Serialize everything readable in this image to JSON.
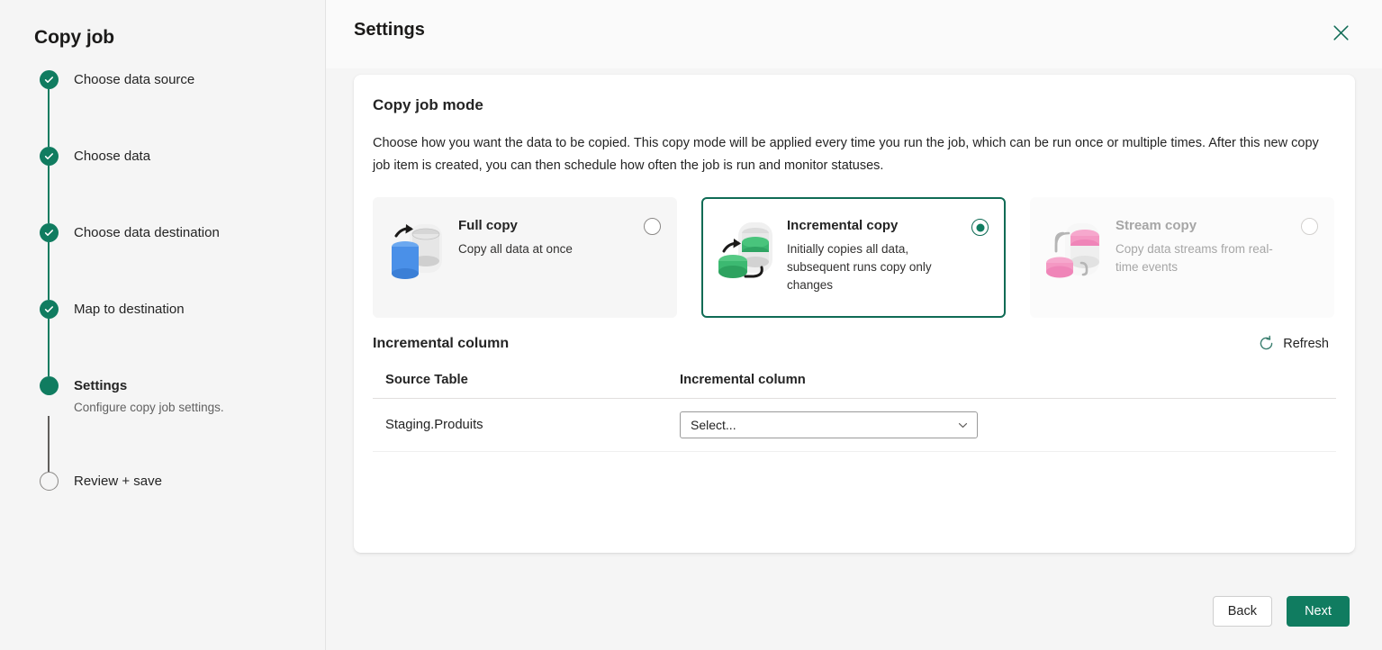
{
  "sidebar": {
    "title": "Copy job",
    "steps": [
      {
        "label": "Choose data source",
        "state": "done",
        "sub": ""
      },
      {
        "label": "Choose data",
        "state": "done",
        "sub": ""
      },
      {
        "label": "Choose data destination",
        "state": "done",
        "sub": ""
      },
      {
        "label": "Map to destination",
        "state": "done",
        "sub": ""
      },
      {
        "label": "Settings",
        "state": "current",
        "sub": "Configure copy job settings."
      },
      {
        "label": "Review + save",
        "state": "todo",
        "sub": ""
      }
    ]
  },
  "header": {
    "title": "Settings",
    "close_icon": "close-icon"
  },
  "panel": {
    "title": "Copy job mode",
    "description": "Choose how you want the data to be copied. This copy mode will be applied every time you run the job, which can be run once or multiple times. After this new copy job item is created, you can then schedule how often the job is run and monitor statuses.",
    "modes": [
      {
        "name": "Full copy",
        "sub": "Copy all data at once",
        "selected": false,
        "disabled": false,
        "icon": "database-full-copy-icon"
      },
      {
        "name": "Incremental copy",
        "sub": "Initially copies all data, subsequent runs copy only changes",
        "selected": true,
        "disabled": false,
        "icon": "database-incremental-copy-icon"
      },
      {
        "name": "Stream copy",
        "sub": "Copy data streams from real-time events",
        "selected": false,
        "disabled": true,
        "icon": "database-stream-copy-icon"
      }
    ]
  },
  "incremental": {
    "section_title": "Incremental column",
    "refresh_label": "Refresh",
    "refresh_icon": "refresh-icon",
    "columns": [
      "Source Table",
      "Incremental column"
    ],
    "rows": [
      {
        "source_table": "Staging.Produits",
        "incremental_column": "Select..."
      }
    ]
  },
  "footer": {
    "back_label": "Back",
    "next_label": "Next"
  },
  "colors": {
    "accent_green": "#107c60",
    "selected_border": "#0f6b55",
    "page_bg": "#f5f5f5",
    "panel_bg": "#ffffff",
    "text_primary": "#242424",
    "text_secondary": "#616161",
    "disabled_text": "#a6a6a6"
  }
}
